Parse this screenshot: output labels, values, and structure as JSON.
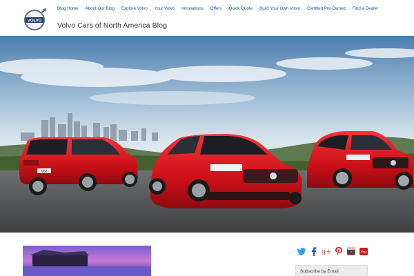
{
  "site": {
    "title": "Volvo Cars of North America Blog",
    "logo_text": "VOLVO"
  },
  "nav": {
    "items": [
      {
        "label": "Blog Home"
      },
      {
        "label": "About Our Blog"
      },
      {
        "label": "Explore Volvo"
      },
      {
        "label": "Your Volvo"
      },
      {
        "label": "Innovations"
      },
      {
        "label": "Offers"
      },
      {
        "label": "Quick Quote"
      },
      {
        "label": "Build Your Own Volvo"
      },
      {
        "label": "Certified Pre Owned"
      },
      {
        "label": "Find a Dealer"
      }
    ]
  },
  "hero": {
    "plate_text": "V60"
  },
  "social": {
    "icons": [
      "twitter-icon",
      "facebook-icon",
      "google-plus-icon",
      "pinterest-icon",
      "instagram-icon",
      "youtube-icon"
    ],
    "gplus_text": "g+",
    "youtube_text": "You"
  },
  "sidebar": {
    "subscribe_label": "Subscribe by Email"
  },
  "colors": {
    "nav_text": "#1f4d86",
    "car_red": "#d0121b",
    "twitter": "#2aa3e0",
    "facebook": "#3b5998",
    "google": "#d34836",
    "pinterest": "#cb2027",
    "youtube": "#cc181e"
  }
}
